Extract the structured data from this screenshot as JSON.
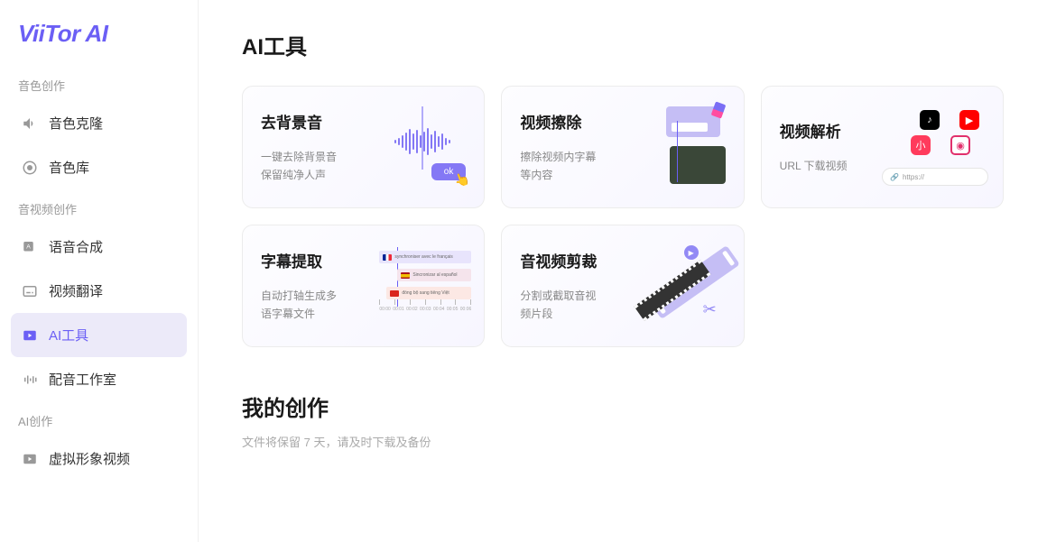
{
  "logo": "ViiTor AI",
  "sidebar": {
    "sections": [
      {
        "label": "音色创作",
        "items": [
          {
            "label": "音色克隆",
            "active": false
          },
          {
            "label": "音色库",
            "active": false
          }
        ]
      },
      {
        "label": "音视频创作",
        "items": [
          {
            "label": "语音合成",
            "active": false
          },
          {
            "label": "视频翻译",
            "active": false
          },
          {
            "label": "AI工具",
            "active": true
          },
          {
            "label": "配音工作室",
            "active": false
          }
        ]
      },
      {
        "label": "AI创作",
        "items": [
          {
            "label": "虚拟形象视频",
            "active": false
          }
        ]
      }
    ]
  },
  "page": {
    "title": "AI工具",
    "tools": [
      {
        "title": "去背景音",
        "desc": "一键去除背景音\n保留纯净人声"
      },
      {
        "title": "视频擦除",
        "desc": "擦除视频内字幕\n等内容"
      },
      {
        "title": "视频解析",
        "desc": "URL 下载视频"
      },
      {
        "title": "字幕提取",
        "desc": "自动打轴生成多\n语字幕文件"
      },
      {
        "title": "音视频剪裁",
        "desc": "分割或截取音视\n频片段"
      }
    ],
    "illus": {
      "ok": "ok",
      "url_placeholder": "https://"
    },
    "creations": {
      "title": "我的创作",
      "subtitle": "文件将保留 7 天，请及时下载及备份"
    }
  }
}
